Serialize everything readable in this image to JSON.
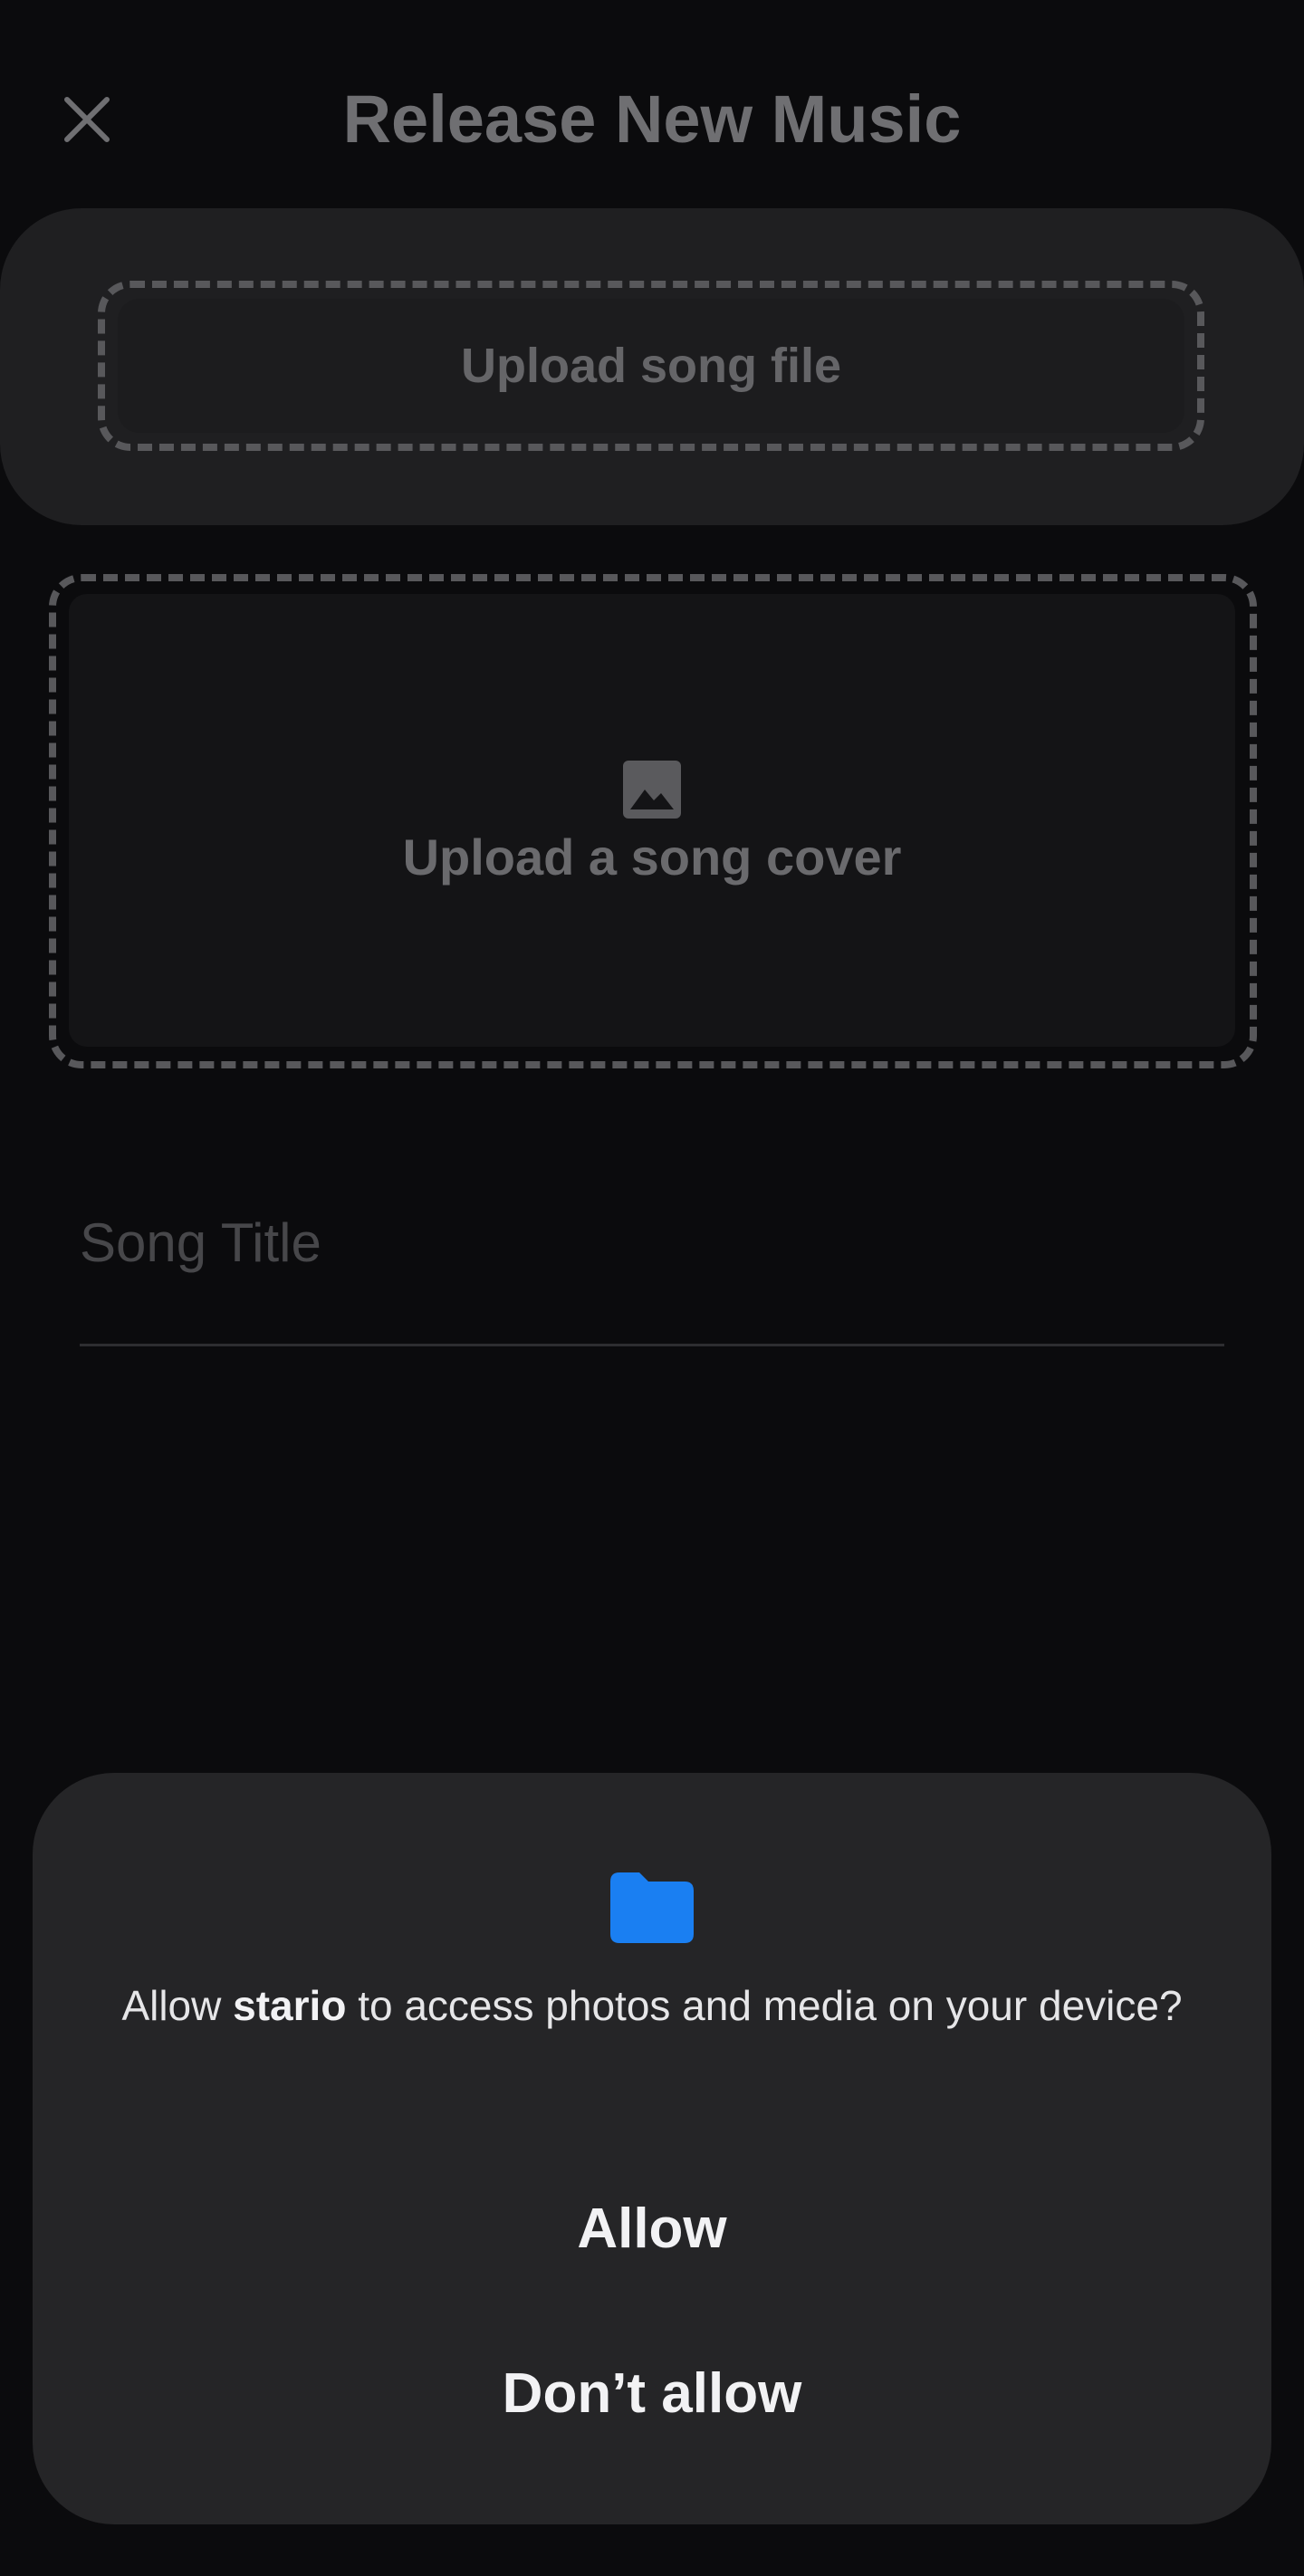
{
  "header": {
    "title": "Release New Music",
    "close_icon": "close-icon"
  },
  "upload_song_file": {
    "label": "Upload song file"
  },
  "upload_cover": {
    "icon": "image-icon",
    "label": "Upload a song cover"
  },
  "song_title": {
    "placeholder": "Song Title",
    "value": ""
  },
  "permission_dialog": {
    "icon": "folder-icon",
    "message_prefix": "Allow ",
    "app_name": "stario",
    "message_suffix": " to access photos and media on your device?",
    "allow_label": "Allow",
    "deny_label": "Don’t allow"
  },
  "colors": {
    "background": "#0b0b0d",
    "dialog_background": "#252527",
    "folder_accent": "#1a7ff2"
  }
}
